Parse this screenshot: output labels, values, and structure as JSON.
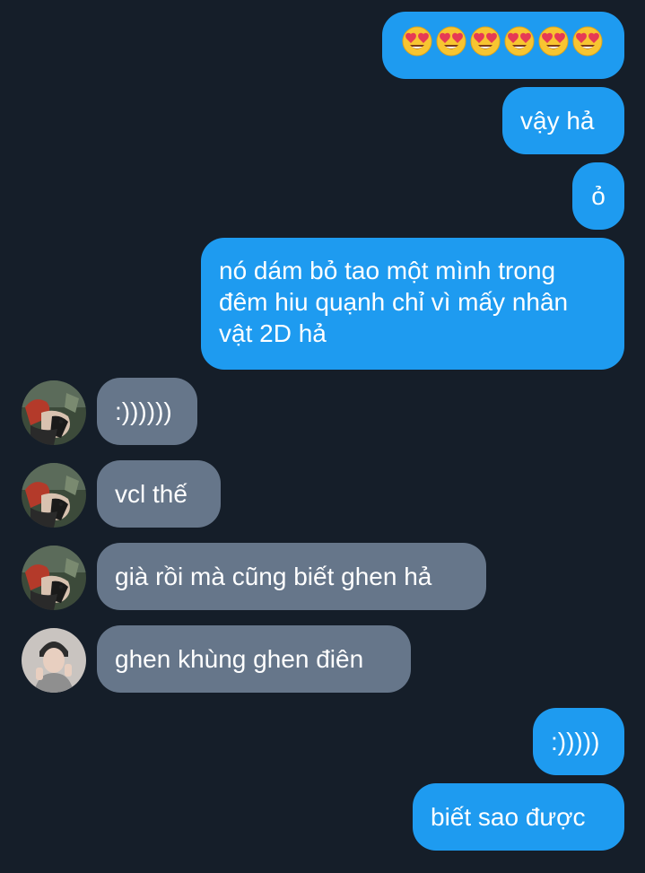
{
  "colors": {
    "background": "#151e29",
    "outgoing_bubble": "#1e9bf0",
    "incoming_bubble": "#66768a",
    "text": "#ffffff"
  },
  "messages": [
    {
      "direction": "outgoing",
      "text": "😍😍😍😍😍😍"
    },
    {
      "direction": "outgoing",
      "text": "vậy hả"
    },
    {
      "direction": "outgoing",
      "text": "ỏ"
    },
    {
      "direction": "outgoing",
      "text": "nó dám bỏ tao một mình trong đêm hiu quạnh chỉ vì mấy nhân vật 2D hả"
    },
    {
      "direction": "incoming",
      "text": ":))))))",
      "avatar": "anime-avatar"
    },
    {
      "direction": "incoming",
      "text": "vcl thế",
      "avatar": "anime-avatar"
    },
    {
      "direction": "incoming",
      "text": "già rồi mà cũng biết ghen hả",
      "avatar": "anime-avatar"
    },
    {
      "direction": "incoming",
      "text": "ghen khùng ghen điên",
      "avatar": "photo-avatar"
    },
    {
      "direction": "outgoing",
      "text": ":)))))"
    },
    {
      "direction": "outgoing",
      "text": "biết sao được"
    }
  ]
}
